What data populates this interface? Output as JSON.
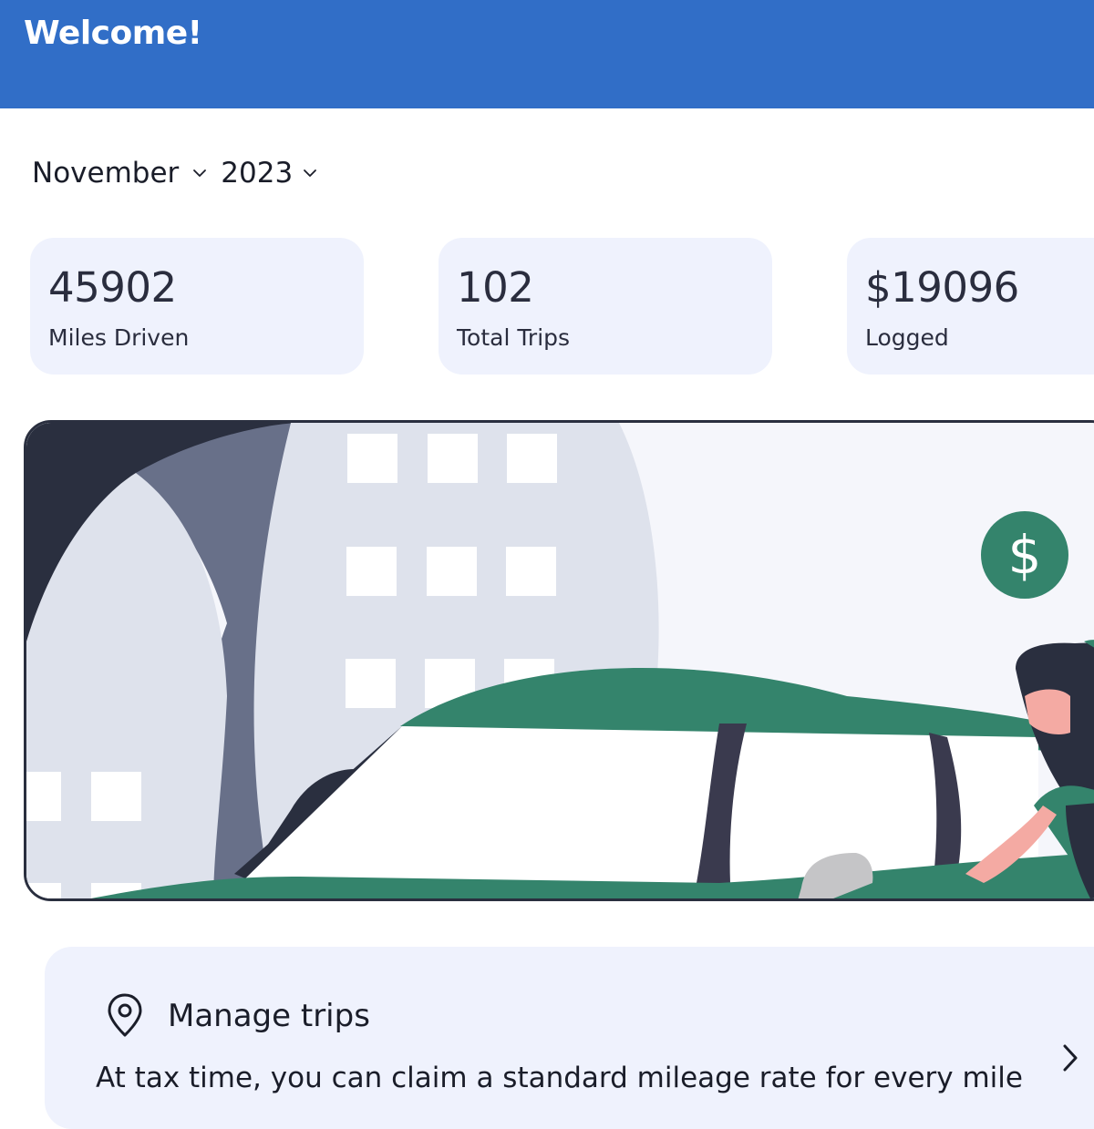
{
  "header": {
    "title": "Welcome!"
  },
  "period": {
    "month": "November",
    "year": "2023"
  },
  "stats": [
    {
      "value": "45902",
      "label": "Miles Driven"
    },
    {
      "value": "102",
      "label": "Total Trips"
    },
    {
      "value": "$19096",
      "label": "Logged"
    }
  ],
  "hero": {
    "coin_symbol": "$"
  },
  "manage_trips": {
    "title": "Manage trips",
    "description": "At tax time, you can claim a standard mileage rate for every mile"
  },
  "icons": {
    "month_chevron": "chevron-down-icon",
    "year_chevron": "chevron-down-icon",
    "manage_pin": "map-pin-icon",
    "manage_arrow": "chevron-right-icon"
  },
  "colors": {
    "header_bg": "#316ec7",
    "card_bg": "#eff2fd",
    "car_green": "#34846c",
    "coin_green": "#34846c"
  }
}
